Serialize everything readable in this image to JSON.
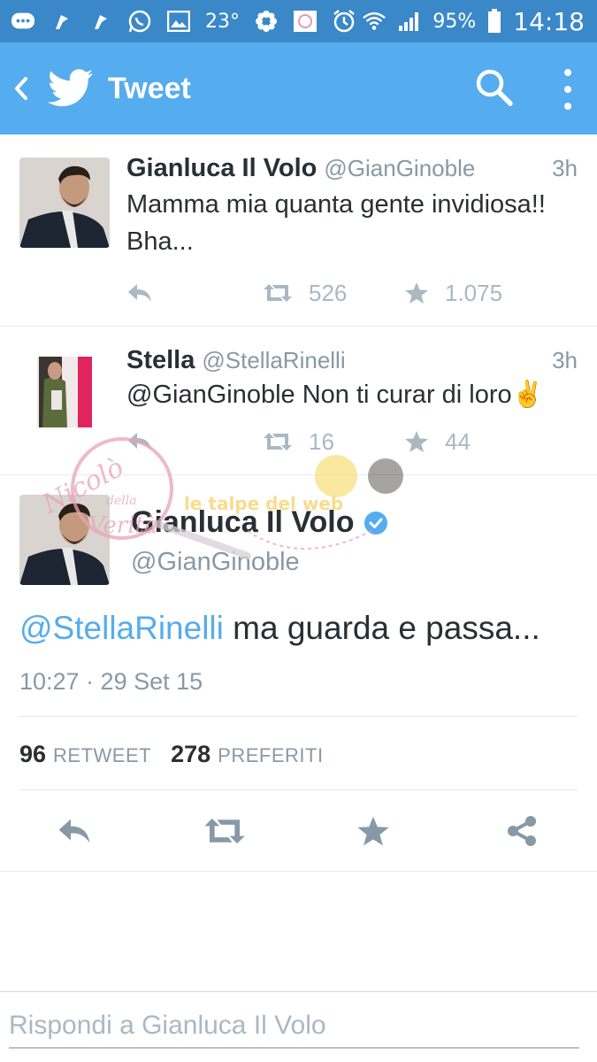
{
  "status_bar": {
    "temperature": "23°",
    "battery": "95%",
    "time": "14:18"
  },
  "app_bar": {
    "title": "Tweet",
    "icons": [
      "back-chevron-icon",
      "twitter-bird-icon",
      "search-icon",
      "more-vert-icon"
    ]
  },
  "tweets": [
    {
      "name": "Gianluca Il Volo",
      "handle": "@GianGinoble",
      "time": "3h",
      "text": "Mamma mia quanta gente invidiosa!! Bha...",
      "retweets": "526",
      "favorites": "1.075"
    },
    {
      "name": "Stella",
      "handle": "@StellaRinelli",
      "time": "3h",
      "text": "@GianGinoble Non ti curar di loro✌️",
      "retweets": "16",
      "favorites": "44"
    }
  ],
  "main_tweet": {
    "name": "Gianluca Il Volo",
    "handle": "@GianGinoble",
    "mention": "@StellaRinelli",
    "text": " ma guarda e passa...",
    "date": "10:27 · 29 Set 15",
    "retweet_count": "96",
    "retweet_label": "RETWEET",
    "favorite_count": "278",
    "favorite_label": "PREFERITI"
  },
  "reply": {
    "placeholder": "Rispondi a Gianluca Il Volo"
  },
  "watermark": {
    "line1": "Nicolò",
    "line2": "della",
    "line3": "Verità",
    "line4": "le talpe del web"
  },
  "colors": {
    "accent": "#55acee",
    "status_bar": "#3a88c8",
    "muted": "#8899a6",
    "icon_gray": "#aab8c2"
  }
}
